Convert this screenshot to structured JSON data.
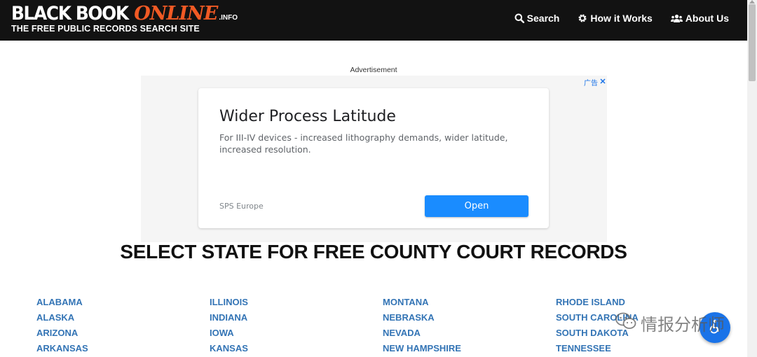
{
  "header": {
    "logo_black": "BLACK BOOK",
    "logo_online": "ONLINE",
    "logo_info": ".INFO",
    "tagline": "THE FREE PUBLIC RECORDS SEARCH SITE",
    "nav": {
      "search_label": "Search",
      "how_it_works_label": "How it Works",
      "about_us_label": "About Us"
    }
  },
  "ad": {
    "label": "Advertisement",
    "badge": "广告",
    "headline": "Wider Process Latitude",
    "description": "For III-IV devices - increased lithography demands, wider latitude, increased resolution.",
    "advertiser": "SPS Europe",
    "cta": "Open"
  },
  "main": {
    "title": "SELECT STATE FOR FREE COUNTY COURT RECORDS",
    "columns": [
      [
        "ALABAMA",
        "ALASKA",
        "ARIZONA",
        "ARKANSAS"
      ],
      [
        "ILLINOIS",
        "INDIANA",
        "IOWA",
        "KANSAS"
      ],
      [
        "MONTANA",
        "NEBRASKA",
        "NEVADA",
        "NEW HAMPSHIRE"
      ],
      [
        "RHODE ISLAND",
        "SOUTH CAROLINA",
        "SOUTH DAKOTA",
        "TENNESSEE"
      ]
    ]
  },
  "watermark": {
    "text": "情报分析师"
  },
  "colors": {
    "header_bg": "#121212",
    "logo_accent": "#f15a24",
    "link": "#3374b5",
    "ad_button": "#1a8cff"
  }
}
